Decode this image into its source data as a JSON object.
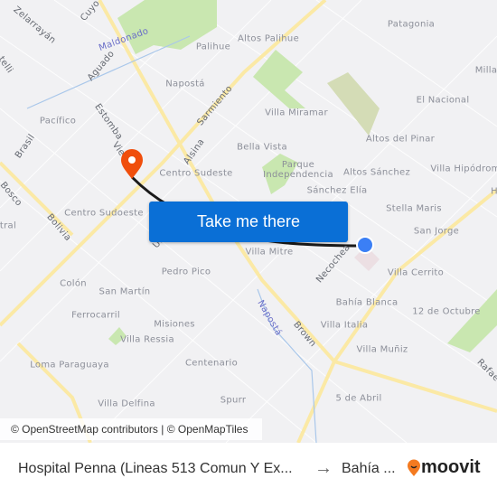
{
  "map": {
    "labels": {
      "zelarrayan": "Zelarrayán",
      "cuyo": "Cuyo",
      "maldonado": "Maldonado",
      "aguado": "Aguado",
      "telli": "telli",
      "palihue": "Palihue",
      "altos_palihue": "Altos Palihue",
      "naposta": "Napostá",
      "sarmiento": "Sarmiento",
      "pacifico": "Pacífico",
      "estomba": "Estomba",
      "vie": "Vie",
      "brasil": "Brasil",
      "alsina": "Alsina",
      "centro_sudeste": "Centro Sudeste",
      "bella_vista": "Bella Vista",
      "villa_miramar": "Villa Miramar",
      "patagonia": "Patagonia",
      "milla": "Milla",
      "el_nacional": "El Nacional",
      "altos_del_pinar": "Altos del Pinar",
      "villa_hipodromo": "Villa Hipódrom",
      "parque_independencia": "Parque Independencia",
      "altos_sanchez": "Altos Sánchez",
      "sanchez_elia": "Sánchez Elía",
      "bosco": "Bosco",
      "bolivia": "Bolivia",
      "centro_sudoeste": "Centro Sudoeste",
      "tral": "tral",
      "stella_maris": "Stella Maris",
      "san_jorge": "San Jorge",
      "villa_mitre": "Villa Mitre",
      "necochea": "Necochea",
      "villa_cerrito": "Villa Cerrito",
      "pedro_pico": "Pedro Pico",
      "colon": "Colón",
      "san_martin": "San Martín",
      "bahia_blanca": "Bahía Blanca",
      "doce_octubre": "12 de Octubre",
      "ferrocarril": "Ferrocarril",
      "misiones": "Misiones",
      "naposta_river": "Napostá",
      "brown": "Brown",
      "villa_italia": "Villa Italia",
      "villa_ressia": "Villa Ressia",
      "villa_muniz": "Villa Muñiz",
      "loma_paraguaya": "Loma Paraguaya",
      "centenario": "Centenario",
      "rafa": "Rafae",
      "cinco_abril": "5 de Abril",
      "villa_delfina": "Villa Delfina",
      "spurr": "Spurr",
      "h": "H",
      "un": "Un"
    },
    "cta_label": "Take me there",
    "attribution": "© OpenStreetMap contributors | © OpenMapTiles",
    "colors": {
      "route": "#1a1a1a",
      "origin_pin": "#f04e0c",
      "destination_dot": "#3b7ff5",
      "button": "#0a6fd6",
      "park": "#c9e7b0",
      "road": "#fbe9a5"
    }
  },
  "footer": {
    "origin": "Hospital Penna (Lineas 513 Comun Y Ex...",
    "arrow": "→",
    "destination": "Bahía ...",
    "brand": "moovit"
  }
}
